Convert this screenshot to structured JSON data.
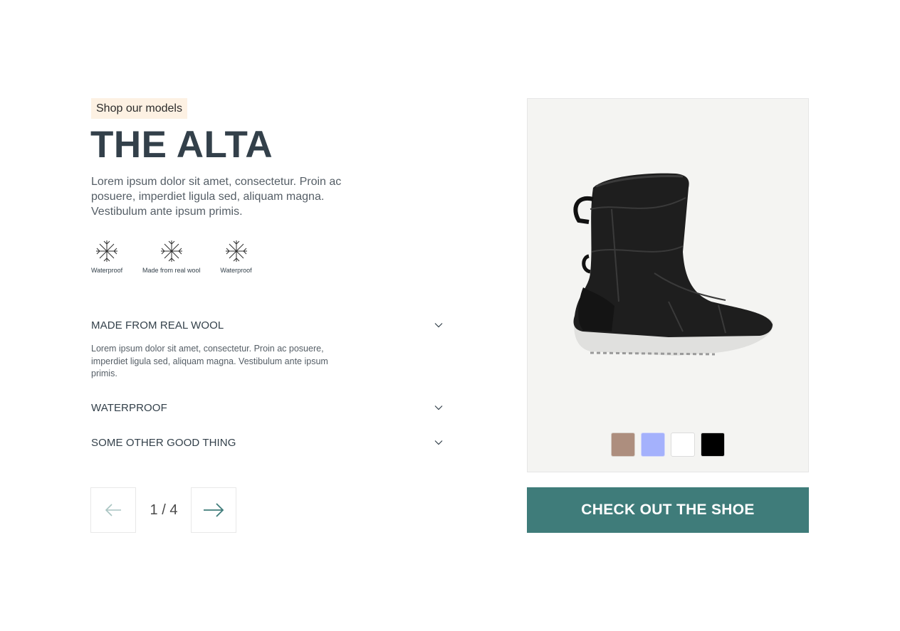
{
  "tag": "Shop our models",
  "title": "THE ALTA",
  "intro": "Lorem ipsum dolor sit amet, consectetur. Proin ac posuere, imperdiet ligula sed, aliquam magna. Vestibulum ante ipsum primis.",
  "features": [
    {
      "icon": "snowflake-icon",
      "label": "Waterproof"
    },
    {
      "icon": "snowflake-icon",
      "label": "Made from real wool"
    },
    {
      "icon": "snowflake-icon",
      "label": "Waterproof"
    }
  ],
  "accordion": [
    {
      "title": "MADE FROM REAL WOOL",
      "body": "Lorem ipsum dolor sit amet, consectetur. Proin ac posuere, imperdiet ligula sed, aliquam magna. Vestibulum ante ipsum primis.",
      "expanded": true
    },
    {
      "title": "WATERPROOF",
      "expanded": false
    },
    {
      "title": "SOME OTHER GOOD THING",
      "expanded": false
    }
  ],
  "pager": {
    "count": "1 / 4",
    "current": 1,
    "total": 4
  },
  "swatches": [
    {
      "name": "tan",
      "color": "#ad8e7e"
    },
    {
      "name": "blue",
      "color": "#a4b1fc"
    },
    {
      "name": "white",
      "color": "#ffffff"
    },
    {
      "name": "black",
      "color": "#000000"
    }
  ],
  "cta": "CHECK OUT THE SHOE",
  "colors": {
    "accent": "#3f7c7a",
    "text": "#33404a",
    "tag_bg": "#fdf1e3",
    "panel_bg": "#f4f4f2"
  }
}
